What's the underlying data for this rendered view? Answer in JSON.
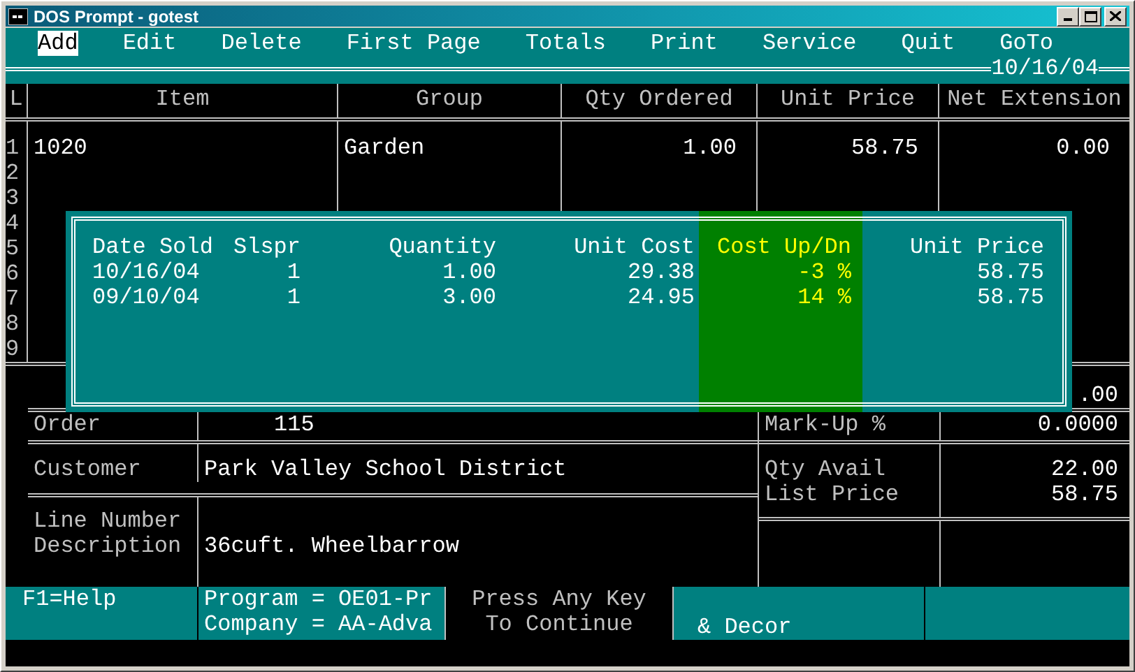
{
  "window": {
    "title": "DOS Prompt - gotest"
  },
  "menu": [
    {
      "label": "Add",
      "selected": true
    },
    {
      "label": "Edit",
      "selected": false
    },
    {
      "label": "Delete",
      "selected": false
    },
    {
      "label": "First Page",
      "selected": false
    },
    {
      "label": "Totals",
      "selected": false
    },
    {
      "label": "Print",
      "selected": false
    },
    {
      "label": "Service",
      "selected": false
    },
    {
      "label": "Quit",
      "selected": false
    },
    {
      "label": "GoTo",
      "selected": false
    }
  ],
  "date": "10/16/04",
  "table": {
    "columns": [
      "L",
      "Item",
      "Group",
      "Qty Ordered",
      "Unit Price",
      "Net Extension"
    ],
    "line_numbers": [
      "1",
      "2",
      "3",
      "4",
      "5",
      "6",
      "7",
      "8",
      "9"
    ],
    "rows": [
      {
        "item": "1020",
        "group": "Garden",
        "qty": "1.00",
        "price": "58.75",
        "net": "0.00"
      }
    ]
  },
  "popup": {
    "columns": [
      {
        "label": "Date Sold",
        "highlighted": false
      },
      {
        "label": "Slspr",
        "highlighted": false
      },
      {
        "label": "Quantity",
        "highlighted": false
      },
      {
        "label": "Unit Cost",
        "highlighted": false
      },
      {
        "label": "Cost Up/Dn",
        "highlighted": true
      },
      {
        "label": "Unit Price",
        "highlighted": false
      }
    ],
    "rows": [
      [
        "10/16/04",
        "1",
        "1.00",
        "29.38",
        "-3 %",
        "58.75"
      ],
      [
        "09/10/04",
        "1",
        "3.00",
        "24.95",
        "14 %",
        "58.75"
      ]
    ]
  },
  "details": {
    "partial_value": ".00",
    "order": {
      "label": "Order",
      "value": "115"
    },
    "markup": {
      "label": "Mark-Up %",
      "value": "0.0000"
    },
    "customer": {
      "label": "Customer",
      "value": "Park Valley School District"
    },
    "qty_avail": {
      "label": "Qty Avail",
      "value": "22.00"
    },
    "list_price": {
      "label": "List Price",
      "value": "58.75"
    },
    "line_number": {
      "label": "Line Number"
    },
    "description": {
      "label": "Description",
      "value": "36cuft. Wheelbarrow"
    }
  },
  "footer": {
    "help": "F1=Help",
    "program": "Program = OE01-Pr",
    "company": "Company = AA-Adva",
    "prompt": [
      "Press Any Key",
      "To Continue"
    ],
    "decor": "& Decor"
  }
}
